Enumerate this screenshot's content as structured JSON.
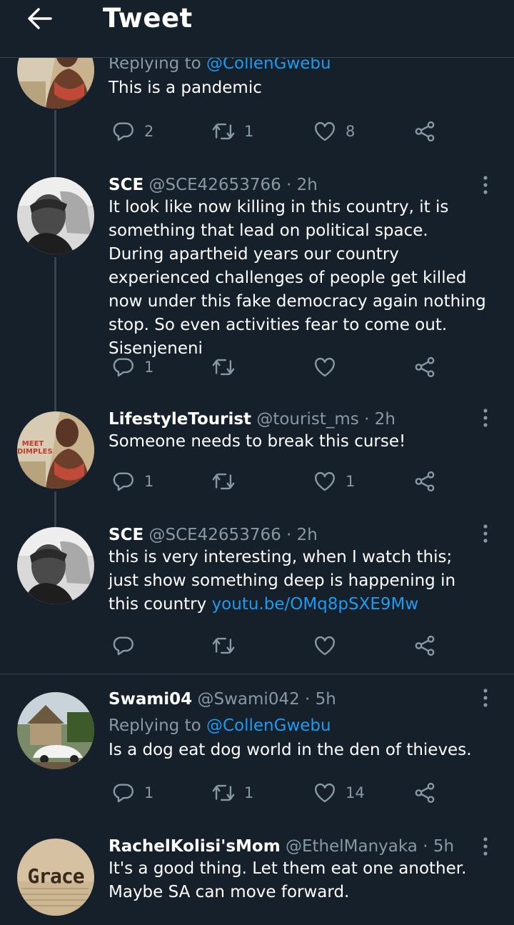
{
  "header": {
    "title": "Tweet"
  },
  "tweets": [
    {
      "replying_label": "Replying to",
      "replying_to": "@CollenGwebu",
      "text": "This is a pandemic",
      "replies": "2",
      "retweets": "1",
      "likes": "8"
    },
    {
      "name": "SCE",
      "handle": "@SCE42653766",
      "time": "· 2h",
      "text": "It look like now killing in this country, it is something that lead on political space. During apartheid years our country experienced challenges of people get killed now under this fake democracy again nothing stop. So even activities fear to come out. Sisenjeneni",
      "replies": "1",
      "retweets": "",
      "likes": ""
    },
    {
      "name": "LifestyleTourist",
      "handle": "@tourist_ms",
      "time": "· 2h",
      "text": "Someone needs to break this curse!",
      "replies": "1",
      "retweets": "",
      "likes": "1",
      "avatar_text": "MEET DIMPLES"
    },
    {
      "name": "SCE",
      "handle": "@SCE42653766",
      "time": "· 2h",
      "text": "this is very interesting, when I watch this; just show something deep is happening in this country",
      "link": "youtu.be/OMq8pSXE9Mw",
      "replies": "",
      "retweets": "",
      "likes": ""
    },
    {
      "name": "Swami04",
      "handle": "@Swami042",
      "time": "· 5h",
      "replying_label": "Replying to",
      "replying_to": "@CollenGwebu",
      "text": "Is a dog eat dog world in the den of thieves.",
      "replies": "1",
      "retweets": "1",
      "likes": "14"
    },
    {
      "name": "RachelKolisi'sMom",
      "handle": "@EthelManyaka",
      "time": "· 5h",
      "text": "It's a good thing. Let them eat one another. Maybe SA can move forward.",
      "avatar_text": "Grace"
    }
  ],
  "colors": {
    "background": "#15202b",
    "muted": "#8899a6",
    "link": "#1d9bf0",
    "divider": "#38444d"
  }
}
